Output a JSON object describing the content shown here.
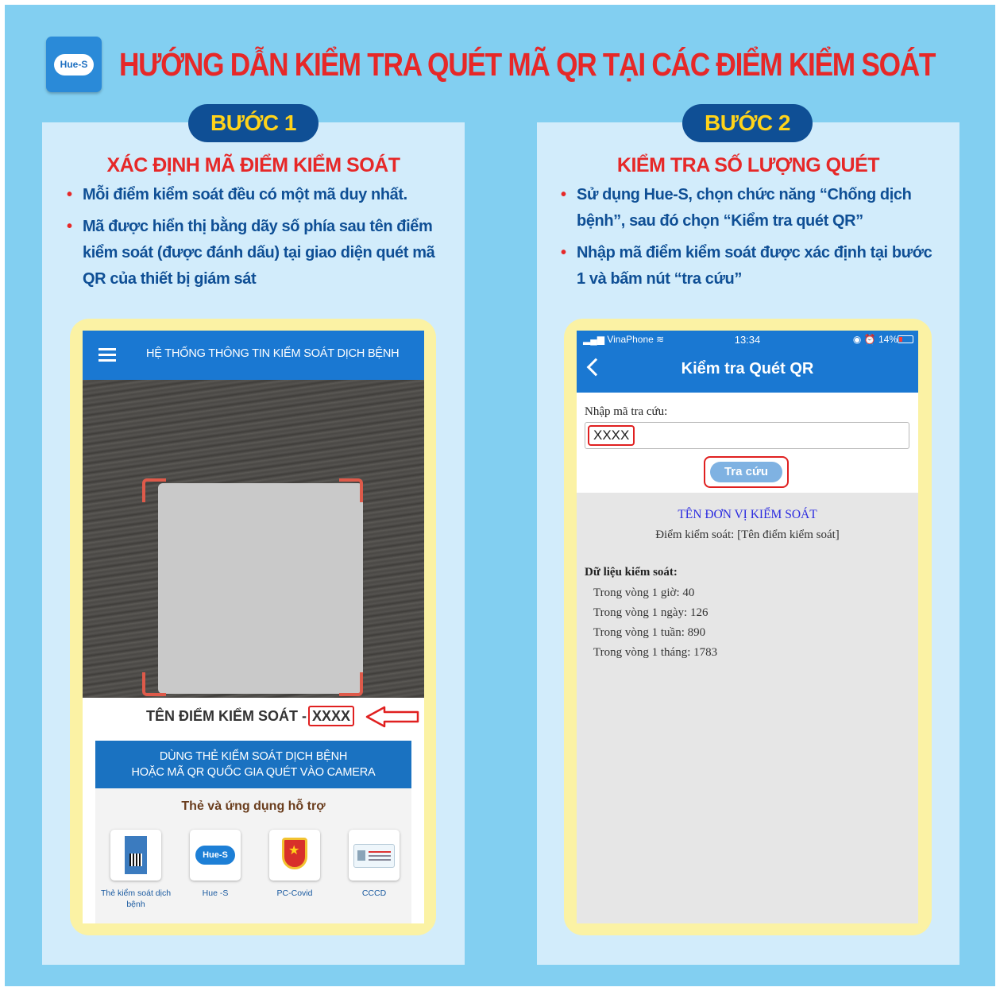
{
  "logo": {
    "text": "Hue-S"
  },
  "title": "HƯỚNG DẪN KIỂM TRA QUÉT MÃ QR TẠI CÁC ĐIỂM KIỂM SOÁT",
  "colors": {
    "background": "#82cff1",
    "panel": "#d2ecfb",
    "pill": "#0f4f95",
    "pill_text": "#ffd31a",
    "accent_red": "#e62828",
    "app_blue": "#1a78d2",
    "frame": "#fbf2a4"
  },
  "step1": {
    "label": "BƯỚC 1",
    "heading": "XÁC ĐỊNH MÃ ĐIỂM KIỂM SOÁT",
    "bullets": [
      "Mỗi điểm kiểm soát đều có một mã duy nhất.",
      "Mã được hiển thị bằng dãy số phía sau tên điểm kiểm soát (được đánh dấu) tại giao diện quét mã QR của thiết bị giám sát"
    ],
    "phone": {
      "header_title": "HỆ THỐNG THÔNG TIN KIỂM SOÁT DỊCH BỆNH",
      "checkpoint_name": "TÊN ĐIỂM KIỂM SOÁT -",
      "checkpoint_code": "XXXX",
      "banner_line1": "DÙNG THẺ KIỂM SOÁT DỊCH BỆNH",
      "banner_line2": "HOẶC MÃ QR QUỐC GIA QUÉT VÀO CAMERA",
      "support_title": "Thẻ và ứng dụng hỗ trợ",
      "apps": [
        {
          "label": "Thẻ kiểm soát dịch bệnh",
          "icon": "card-icon"
        },
        {
          "label": "Hue -S",
          "icon": "hue-s-icon"
        },
        {
          "label": "PC-Covid",
          "icon": "shield-icon"
        },
        {
          "label": "CCCD",
          "icon": "id-card-icon"
        }
      ],
      "hue_icon_text": "Hue-S"
    }
  },
  "step2": {
    "label": "BƯỚC 2",
    "heading": "KIỂM TRA SỐ LƯỢNG QUÉT",
    "bullets": [
      "Sử dụng Hue-S, chọn chức năng “Chống dịch bệnh”, sau đó chọn “Kiểm tra quét QR”",
      "Nhập mã điểm kiểm soát được xác định tại bước 1 và bấm nút “tra cứu”"
    ],
    "phone": {
      "carrier": "VinaPhone",
      "time": "13:34",
      "battery": "14%",
      "title": "Kiểm tra Quét QR",
      "lookup_label": "Nhập mã tra cứu:",
      "lookup_value": "XXXX",
      "lookup_button": "Tra cứu",
      "unit_name": "TÊN ĐƠN VỊ KIỂM SOÁT",
      "checkpoint_line": "Điểm kiểm soát: [Tên điểm kiểm soát]",
      "data_title": "Dữ liệu kiểm soát:",
      "stats": [
        "Trong vòng 1 giờ: 40",
        "Trong vòng 1 ngày: 126",
        "Trong vòng 1 tuần: 890",
        "Trong vòng 1 tháng: 1783"
      ]
    }
  }
}
